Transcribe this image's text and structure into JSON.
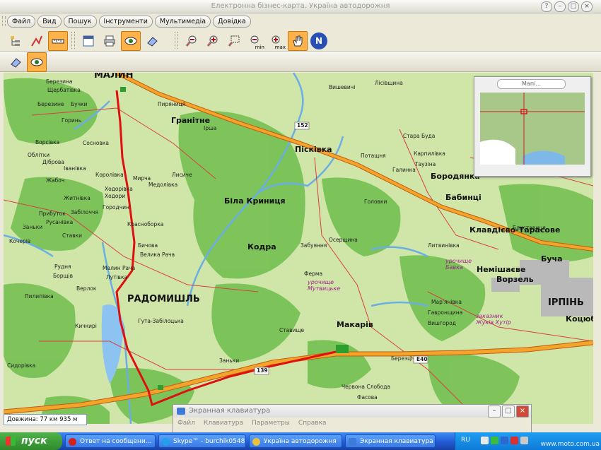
{
  "window": {
    "title": "Електронна бізнес-карта. Україна автодорожня"
  },
  "menu": [
    "Файл",
    "Вид",
    "Пошук",
    "Інструменти",
    "Мультимедіа",
    "Довідка"
  ],
  "toolbar": {
    "zoom_min_label": "min",
    "zoom_max_label": "max",
    "north_label": "N"
  },
  "overview": {
    "title": "Мапі..."
  },
  "map": {
    "towns": [
      {
        "name": "МАЛИН",
        "size": "big"
      },
      {
        "name": "РАДОМИШЛЬ",
        "size": "big"
      },
      {
        "name": "ІРПІНЬ",
        "size": "big"
      },
      {
        "name": "Бородянка",
        "size": "mid"
      },
      {
        "name": "Пісківка",
        "size": "mid"
      },
      {
        "name": "Біла Криниця",
        "size": "mid"
      },
      {
        "name": "Кодра",
        "size": "mid"
      },
      {
        "name": "Гранітне",
        "size": "mid"
      },
      {
        "name": "Бабинці",
        "size": "mid"
      },
      {
        "name": "Клавдієво-Тарасове",
        "size": "mid"
      },
      {
        "name": "Буча",
        "size": "mid"
      },
      {
        "name": "Немішаєве",
        "size": "mid"
      },
      {
        "name": "Ворзель",
        "size": "mid"
      },
      {
        "name": "Макарів",
        "size": "mid"
      },
      {
        "name": "Коцюбі",
        "size": "mid"
      }
    ],
    "villages": [
      "Щербатівка",
      "Бучки",
      "Березине",
      "Горинь",
      "Сосновка",
      "Ворсівка",
      "Іванівка",
      "Облітки",
      "Діброва",
      "Королівка",
      "Жабоч",
      "Мирча",
      "Ходорівка",
      "Медолівка",
      "Лисиче",
      "Ходори",
      "Городчин",
      "Прибуток",
      "Забілоччя",
      "Русанівка",
      "Ставки",
      "Житнівка",
      "Заньки",
      "Кочерів",
      "Красноборка",
      "Бичова",
      "Велика Рача",
      "Малин Рача",
      "Лутівка",
      "Борщів",
      "Рудня",
      "Верлок",
      "Пилипівка",
      "Кичкирі",
      "Гута-Забілоцька",
      "Сидорівка",
      "Заньки",
      "Ставище",
      "Березці",
      "Лісівщина",
      "Стара Буда",
      "Таузіна",
      "Пиряниця",
      "Головки",
      "Ірша",
      "Березина",
      "Вишевичі",
      "Фасова",
      "Червона Слобода",
      "Гавронщина",
      "Мар'янівка",
      "Вишгород",
      "Блиставиця",
      "Ферма",
      "Забуяння",
      "Осерщина",
      "Потащня",
      "Галинка",
      "Карпилівка",
      "Литвинівка"
    ],
    "roads": [
      "152",
      "139",
      "E40"
    ],
    "poi": [
      {
        "text": "урочище Мутвицьке"
      },
      {
        "text": "урочище Бавка"
      },
      {
        "text": "заказник Жуків Хутір"
      }
    ]
  },
  "status": {
    "length": "Довжина: 77 км 935 м"
  },
  "keyboard": {
    "title": "Экранная клавиатура",
    "menu": [
      "Файл",
      "Клавиатура",
      "Параметры",
      "Справка"
    ]
  },
  "taskbar": {
    "start": "пуск",
    "tasks": [
      "Ответ на сообщени...",
      "Skype™ - burchik0548",
      "Україна автодорожня",
      "Экранная клавиатура"
    ],
    "lang": "RU"
  },
  "watermark": "www.moto.com.ua",
  "colors": {
    "route": "#e01010",
    "highway": "#e08b1c",
    "forest": "#5fb54a",
    "field": "#cfe6a8",
    "river": "#7db8e8"
  }
}
